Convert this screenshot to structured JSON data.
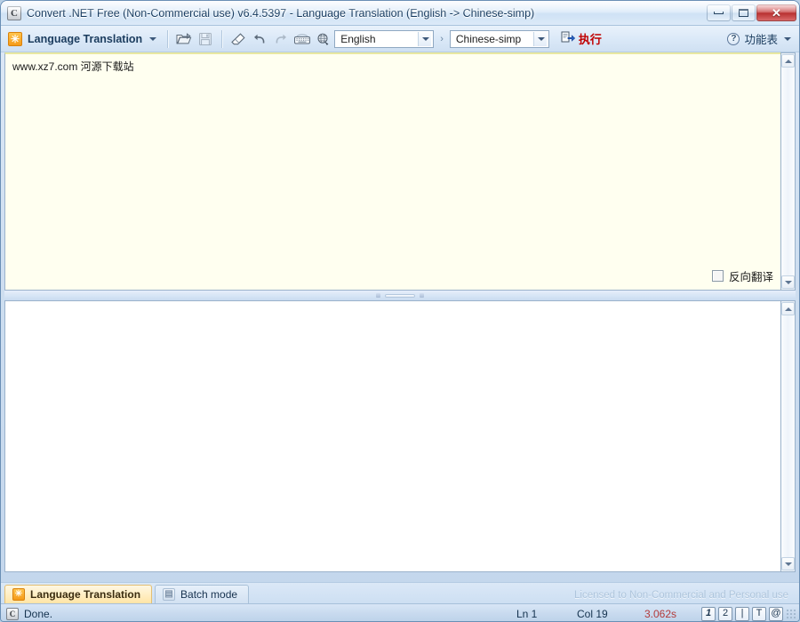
{
  "window": {
    "title": "Convert .NET Free (Non-Commercial use) v6.4.5397 - Language Translation (English -> Chinese-simp)",
    "app_icon": "C",
    "minimize_label": "Minimize",
    "maximize_label": "Maximize",
    "close_label": "✕"
  },
  "toolbar": {
    "module_icon": "✳",
    "module_label": "Language Translation",
    "icons": [
      {
        "name": "open-file-icon",
        "title": "Open",
        "enabled": true
      },
      {
        "name": "save-file-icon",
        "title": "Save",
        "enabled": false
      },
      {
        "name": "eraser-icon",
        "title": "Clear",
        "enabled": true
      },
      {
        "name": "undo-icon",
        "title": "Undo",
        "enabled": true
      },
      {
        "name": "redo-icon",
        "title": "Redo",
        "enabled": false
      },
      {
        "name": "keyboard-icon",
        "title": "Keyboard",
        "enabled": true
      },
      {
        "name": "web-globe-icon",
        "title": "Web",
        "enabled": true
      }
    ],
    "source_language": "English",
    "arrow_separator": "›",
    "target_language": "Chinese-simp",
    "execute_label": "执行",
    "help_icon": "?",
    "help_label": "功能表"
  },
  "editor_top": {
    "content": "www.xz7.com 河源下载站",
    "reverse_checkbox_label": "反向翻译",
    "reverse_checked": false
  },
  "editor_bottom": {
    "content": ""
  },
  "tabs": [
    {
      "label": "Language Translation",
      "icon": "✳",
      "active": true
    },
    {
      "label": "Batch mode",
      "icon": "▤",
      "active": false
    }
  ],
  "license_text": "Licensed to Non-Commercial and Personal use",
  "statusbar": {
    "icon": "C",
    "status": "Done.",
    "line": "Ln 1",
    "column": "Col 19",
    "elapsed": "3.062s",
    "buttons": [
      "1",
      "2",
      "|",
      "T",
      "@"
    ]
  },
  "colors": {
    "accent_orange": "#f59a18",
    "execute_red": "#c00000",
    "elapsed_red": "#b33a3a",
    "editor_top_bg": "#fffff0",
    "editor_bottom_bg": "#ffffff",
    "title_text": "#14395e"
  }
}
